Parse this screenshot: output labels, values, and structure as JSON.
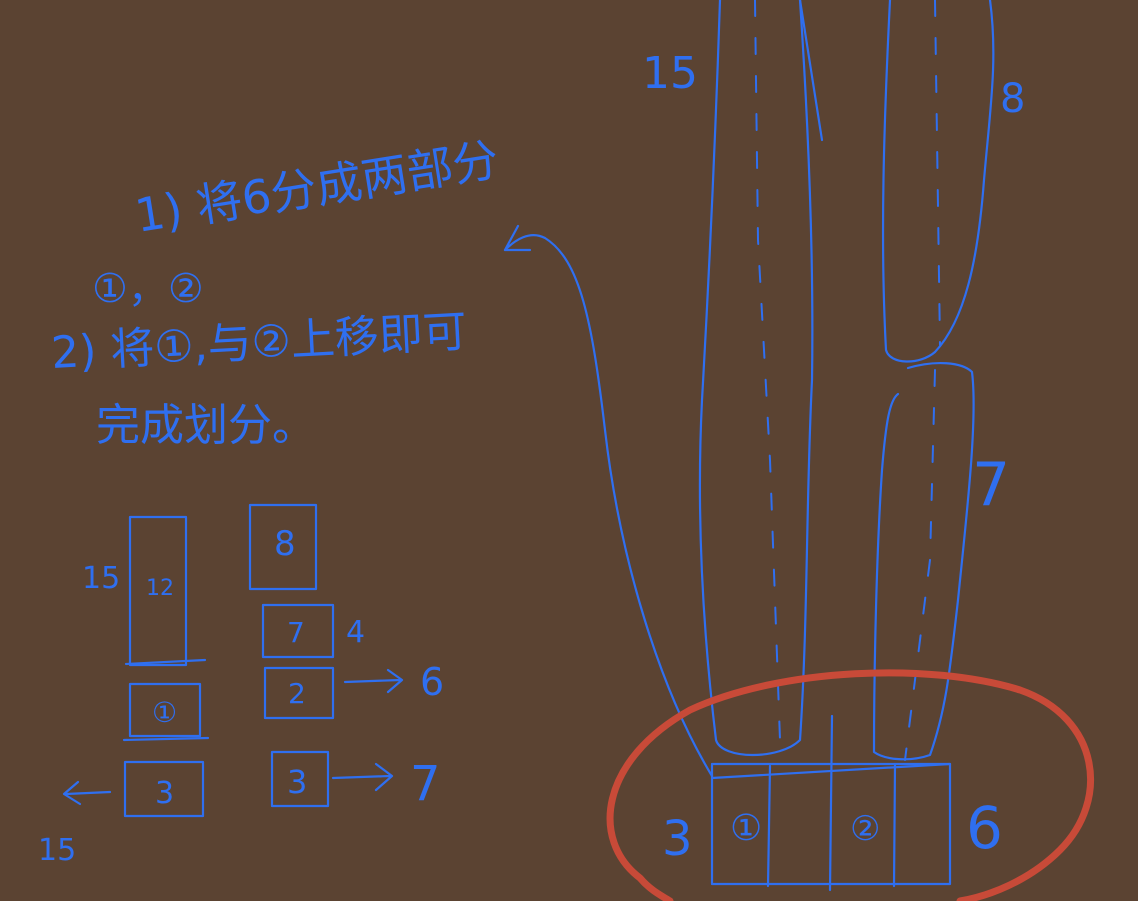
{
  "notes": {
    "line1": "1) 将6分成两部分",
    "line2": "①，②",
    "line3": "2) 将①,与②上移即可",
    "line4": "完成划分。"
  },
  "sketch": {
    "label_15_left": "15",
    "box_12": "12",
    "box_8": "8",
    "box_7": "7",
    "label_4": "4",
    "box_1": "①",
    "box_2": "2",
    "arrow_to_6_label": "6",
    "box_3_left": "3",
    "label_15_bottom": "15",
    "box_3_right": "3",
    "arrow_to_7_label": "7"
  },
  "main": {
    "label_15": "15",
    "label_8": "8",
    "label_7": "7",
    "bottom_3": "3",
    "bottom_1": "①",
    "bottom_2": "②",
    "bottom_6": "6"
  },
  "colors": {
    "ink": "#2f6ff0",
    "highlight": "#c84a38",
    "board": "#5b4332"
  }
}
